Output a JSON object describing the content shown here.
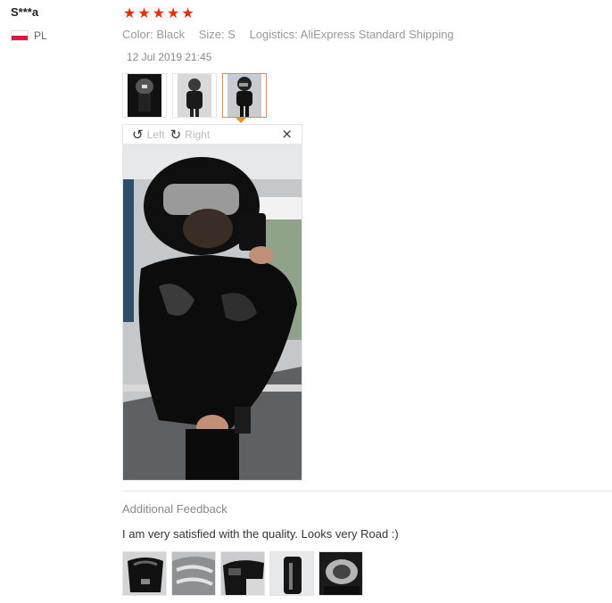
{
  "user": {
    "name": "S***a",
    "country": "PL"
  },
  "rating": {
    "stars": 5,
    "star_glyph": "★"
  },
  "attributes": [
    {
      "label": "Color:",
      "value": "Black"
    },
    {
      "label": "Size:",
      "value": "S"
    },
    {
      "label": "Logistics:",
      "value": "AliExpress Standard Shipping"
    }
  ],
  "date": "12 Jul 2019 21:45",
  "viewer": {
    "left_label": "Left",
    "right_label": "Right",
    "close_glyph": "×",
    "rotate_left_glyph": "↺",
    "rotate_right_glyph": "↻"
  },
  "additional": {
    "title": "Additional Feedback",
    "text": "I am very satisfied with the quality. Looks very Road :)"
  },
  "colors": {
    "accent": "#e62e04",
    "thumb_active_border": "#f28c28"
  }
}
